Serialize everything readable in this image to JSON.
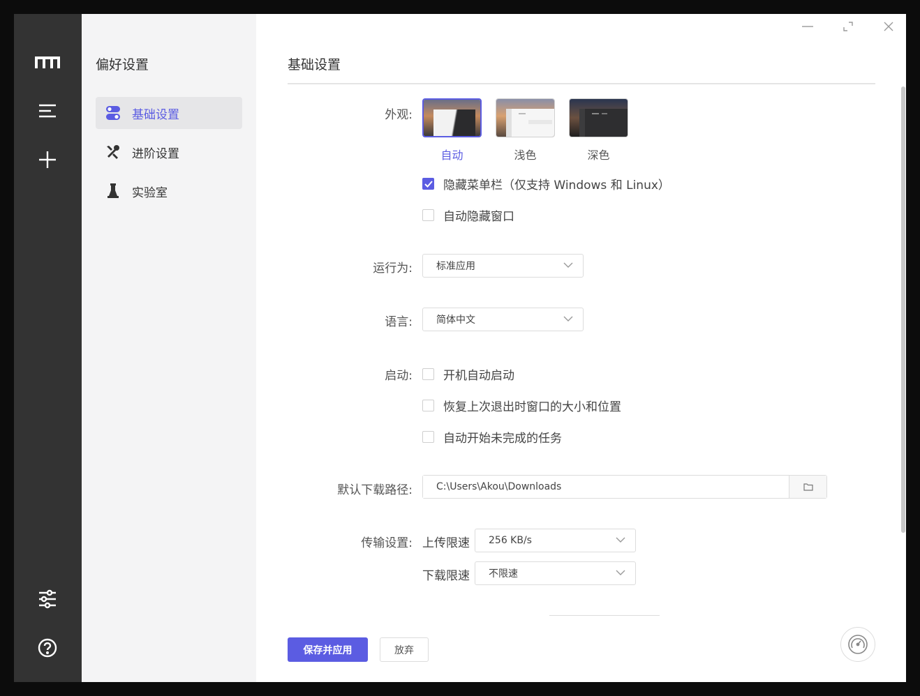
{
  "sidebar": {
    "title": "偏好设置",
    "items": [
      {
        "label": "基础设置",
        "icon": "toggle-icon",
        "active": true
      },
      {
        "label": "进阶设置",
        "icon": "tools-icon",
        "active": false
      },
      {
        "label": "实验室",
        "icon": "lab-icon",
        "active": false
      }
    ]
  },
  "rail": {
    "icons": [
      "logo-icon",
      "menu-icon",
      "add-icon",
      "sliders-icon",
      "help-icon"
    ]
  },
  "main": {
    "title": "基础设置",
    "appearance": {
      "label": "外观:",
      "options": [
        "自动",
        "浅色",
        "深色"
      ],
      "selected": "自动"
    },
    "hide_menubar": {
      "label": "隐藏菜单栏（仅支持 Windows 和 Linux）",
      "checked": true
    },
    "auto_hide_window": {
      "label": "自动隐藏窗口",
      "checked": false
    },
    "run_as": {
      "label": "运行为:",
      "value": "标准应用"
    },
    "language": {
      "label": "语言:",
      "value": "简体中文"
    },
    "startup": {
      "label": "启动:",
      "options": [
        {
          "label": "开机自动启动",
          "checked": false
        },
        {
          "label": "恢复上次退出时窗口的大小和位置",
          "checked": false
        },
        {
          "label": "自动开始未完成的任务",
          "checked": false
        }
      ]
    },
    "download_path": {
      "label": "默认下载路径:",
      "value": "C:\\Users\\Akou\\Downloads"
    },
    "transfer": {
      "label": "传输设置:",
      "upload_label": "上传限速",
      "upload_value": "256 KB/s",
      "download_label": "下载限速",
      "download_value": "不限速"
    },
    "buttons": {
      "save": "保存并应用",
      "discard": "放弃"
    }
  },
  "colors": {
    "accent": "#5b5ce2",
    "rail": "#333333",
    "sidebar": "#f4f4f5"
  }
}
